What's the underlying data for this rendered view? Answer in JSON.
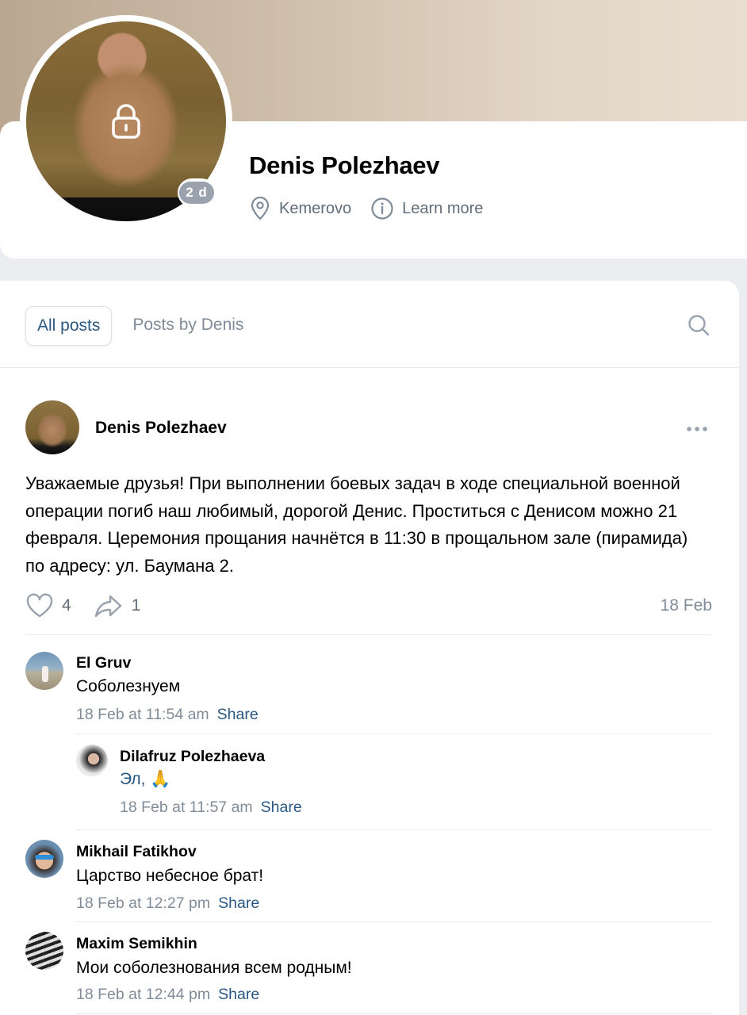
{
  "profile": {
    "name": "Denis Polezhaev",
    "online_badge": "2 d",
    "location": "Kemerovo",
    "learn_more": "Learn more"
  },
  "tabs": {
    "all_posts": "All posts",
    "posts_by": "Posts by Denis"
  },
  "post": {
    "author": "Denis Polezhaev",
    "text": "Уважаемые друзья! При выполнении боевых задач в ходе специальной военной операции погиб наш любимый, дорогой Денис. Проститься с Денисом можно 21 февраля. Церемония прощания начнётся в 11:30 в прощальном зале (пирамида) по адресу: ул. Баумана 2.",
    "likes": "4",
    "shares": "1",
    "date": "18 Feb"
  },
  "comments": [
    {
      "name": "El Gruv",
      "text": "Соболезнуем",
      "time": "18 Feb at 11:54 am",
      "share": "Share"
    },
    {
      "name": "Dilafruz Polezhaeva",
      "mention": "Эл,",
      "emoji": "🙏",
      "time": "18 Feb at 11:57 am",
      "share": "Share"
    },
    {
      "name": "Mikhail Fatikhov",
      "text": "Царство небесное брат!",
      "time": "18 Feb at 12:27 pm",
      "share": "Share"
    },
    {
      "name": "Maxim Semikhin",
      "text": "Мои соболезнования всем родным!",
      "time": "18 Feb at 12:44 pm",
      "share": "Share"
    }
  ],
  "colors": {
    "link": "#2a5885",
    "secondary_text": "#818c99",
    "icon": "#99a2ad"
  },
  "icons": [
    "lock-icon",
    "location-pin-icon",
    "info-icon",
    "search-icon",
    "more-icon",
    "heart-icon",
    "share-arrow-icon"
  ]
}
